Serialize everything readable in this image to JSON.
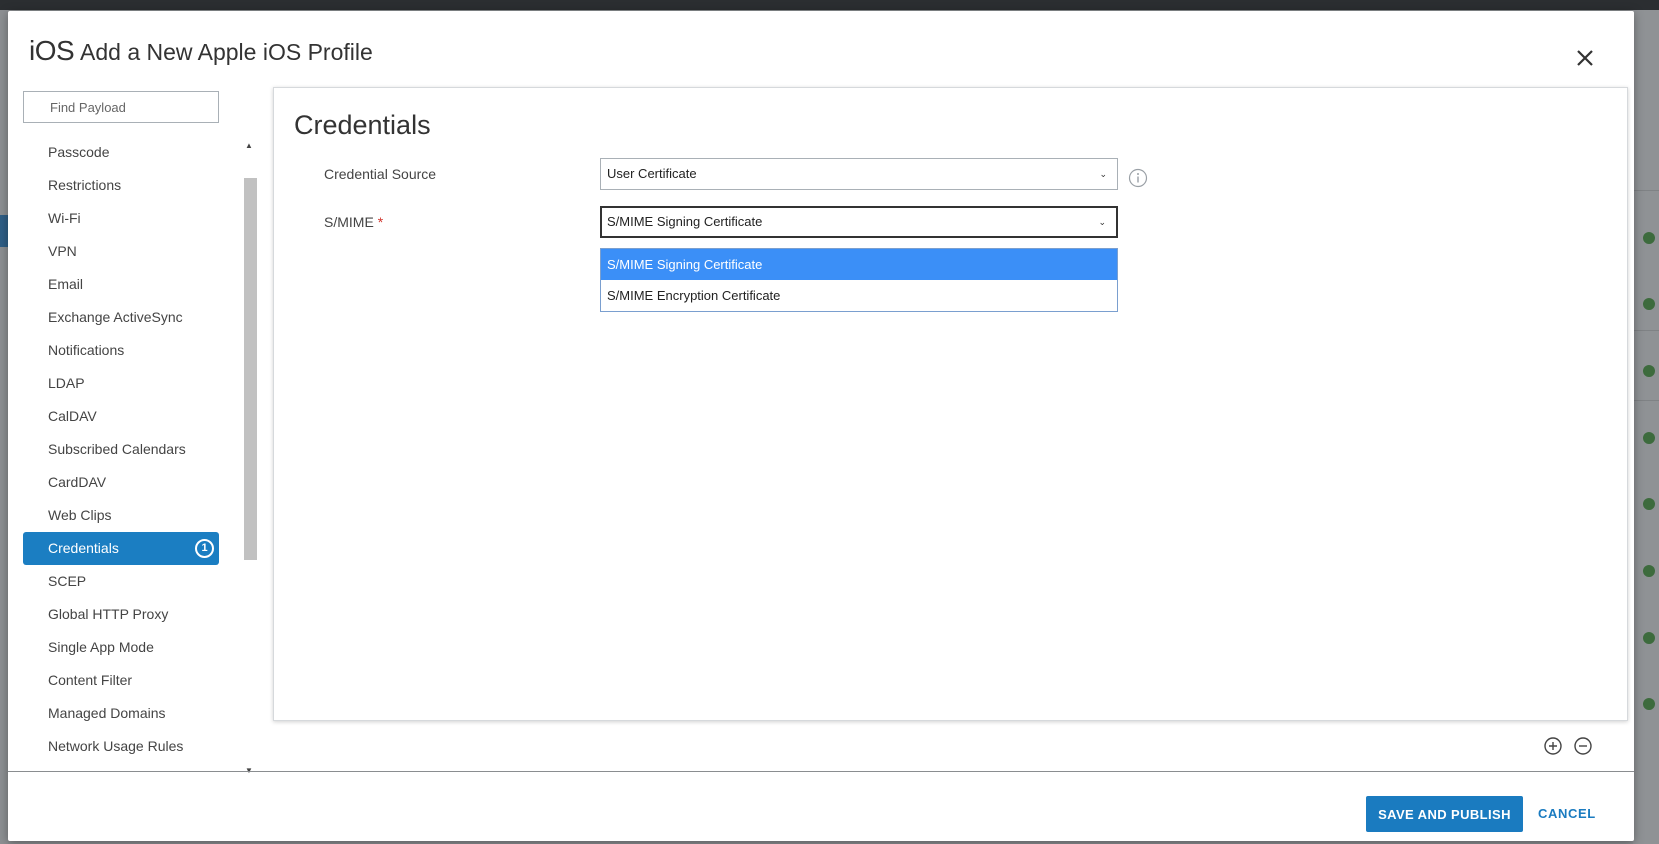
{
  "modal": {
    "logo_text": "iOS",
    "title": "Add a New Apple iOS Profile"
  },
  "sidebar": {
    "search_placeholder": "Find Payload",
    "items": [
      {
        "label": "Passcode"
      },
      {
        "label": "Restrictions"
      },
      {
        "label": "Wi-Fi"
      },
      {
        "label": "VPN"
      },
      {
        "label": "Email"
      },
      {
        "label": "Exchange ActiveSync"
      },
      {
        "label": "Notifications"
      },
      {
        "label": "LDAP"
      },
      {
        "label": "CalDAV"
      },
      {
        "label": "Subscribed Calendars"
      },
      {
        "label": "CardDAV"
      },
      {
        "label": "Web Clips"
      },
      {
        "label": "Credentials",
        "badge": "1",
        "active": true
      },
      {
        "label": "SCEP"
      },
      {
        "label": "Global HTTP Proxy"
      },
      {
        "label": "Single App Mode"
      },
      {
        "label": "Content Filter"
      },
      {
        "label": "Managed Domains"
      },
      {
        "label": "Network Usage Rules"
      }
    ]
  },
  "content": {
    "section_title": "Credentials",
    "credential_source": {
      "label": "Credential Source",
      "value": "User Certificate"
    },
    "smime": {
      "label": "S/MIME",
      "required_mark": "*",
      "value": "S/MIME Signing Certificate",
      "options": [
        "S/MIME Signing Certificate",
        "S/MIME Encryption Certificate"
      ],
      "highlighted_option": "S/MIME Signing Certificate"
    }
  },
  "footer": {
    "save_label": "SAVE AND PUBLISH",
    "cancel_label": "CANCEL"
  },
  "colors": {
    "accent": "#1a7bc0",
    "active_sidebar": "#1b7ec2",
    "dropdown_highlight": "#3b8ff7",
    "required": "#d0342c"
  }
}
